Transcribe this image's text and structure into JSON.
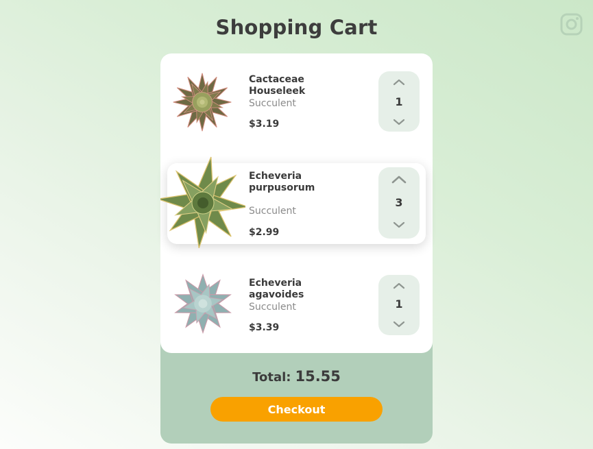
{
  "page": {
    "title": "Shopping Cart"
  },
  "header": {
    "social_icon": "instagram-icon"
  },
  "cart": {
    "items": [
      {
        "name": "Cactaceae Houseleek",
        "type": "Succulent",
        "price": "$3.19",
        "quantity": "1",
        "plant_color": "#7d7a4f"
      },
      {
        "name": "Echeveria purpusorum",
        "type": "Succulent",
        "price": "$2.99",
        "quantity": "3",
        "plant_color": "#86a060"
      },
      {
        "name": "Echeveria agavoides",
        "type": "Succulent",
        "price": "$3.39",
        "quantity": "1",
        "plant_color": "#9bbcbc"
      }
    ],
    "total_label": "Total:",
    "total_value": "15.55",
    "checkout_label": "Checkout"
  },
  "colors": {
    "accent": "#f9a100",
    "cart_footer": "#b2cfba",
    "stepper_bg": "#e6efe8"
  }
}
